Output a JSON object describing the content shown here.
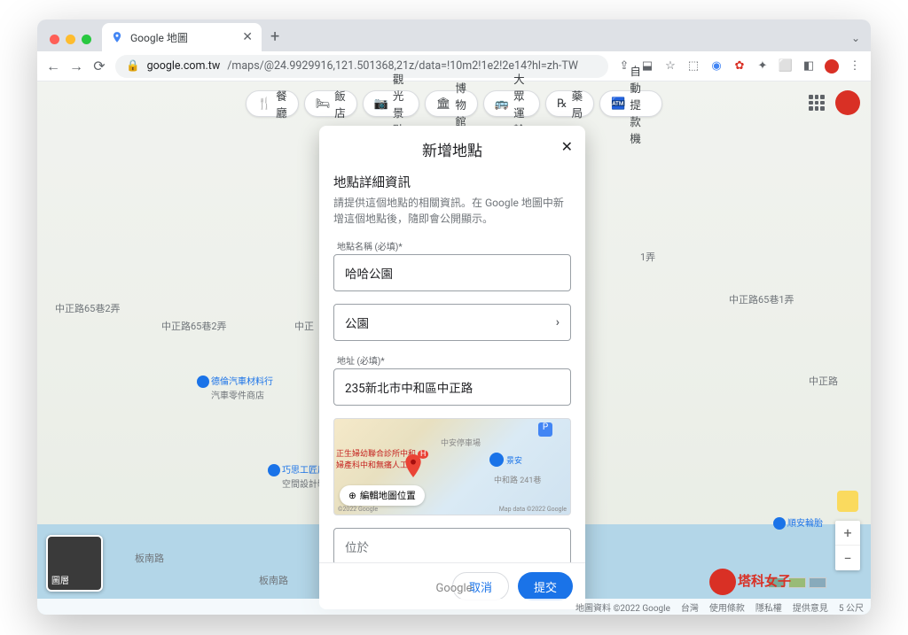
{
  "browser": {
    "tab_title": "Google 地圖",
    "url_host": "google.com.tw",
    "url_path": "/maps/@24.9929916,121.501368,21z/data=!10m2!1e2!2e14?hl=zh-TW"
  },
  "categories": [
    {
      "icon": "🍴",
      "label": "餐廳"
    },
    {
      "icon": "🛏",
      "label": "飯店"
    },
    {
      "icon": "📷",
      "label": "觀光景點"
    },
    {
      "icon": "🏛",
      "label": "博物館"
    },
    {
      "icon": "🚌",
      "label": "大眾運輸"
    },
    {
      "icon": "℞",
      "label": "藥局"
    },
    {
      "icon": "🏧",
      "label": "自動提款機"
    }
  ],
  "dialog": {
    "title": "新增地點",
    "section_title": "地點詳細資訊",
    "section_desc": "請提供這個地點的相關資訊。在 Google 地圖中新增這個地點後，隨即會公開顯示。",
    "name_label": "地點名稱 (必填)*",
    "name_value": "哈哈公園",
    "category_value": "公園",
    "address_label": "地址 (必填)*",
    "address_value": "235新北市中和區中正路",
    "edit_location": "編輯地圖位置",
    "map_copy_left": "©2022 Google",
    "map_copy_right": "Map data ©2022 Google",
    "located_placeholder": "位於",
    "cancel": "取消",
    "submit": "提交",
    "mini_labels": {
      "park": "中安停車場",
      "jingan": "景安",
      "road": "中和路 241巷"
    }
  },
  "map": {
    "roads": {
      "r1": "中正路65巷2弄",
      "r2": "中正路65巷2弄",
      "r3": "中正",
      "r4": "1弄",
      "r5": "中正路65巷1弄",
      "r6": "中正路",
      "r7": "板南路",
      "r8": "板南路"
    },
    "poi": {
      "p1": "德倫汽車材料行",
      "p1s": "汽車零件商店",
      "p2": "巧思工匠居家",
      "p2s": "空間設計裝",
      "p3": "正生婦幼聯合診所中和",
      "p3b": "婦產科中和無痛人工…",
      "p4": "順安輪胎"
    },
    "layers_label": "圖層"
  },
  "footer": {
    "data": "地圖資料 ©2022 Google",
    "country": "台灣",
    "terms": "使用條款",
    "privacy": "隱私權",
    "feedback": "提供意見",
    "scale": "5 公尺"
  },
  "google_logo": "Google",
  "brand": "塔科女子"
}
